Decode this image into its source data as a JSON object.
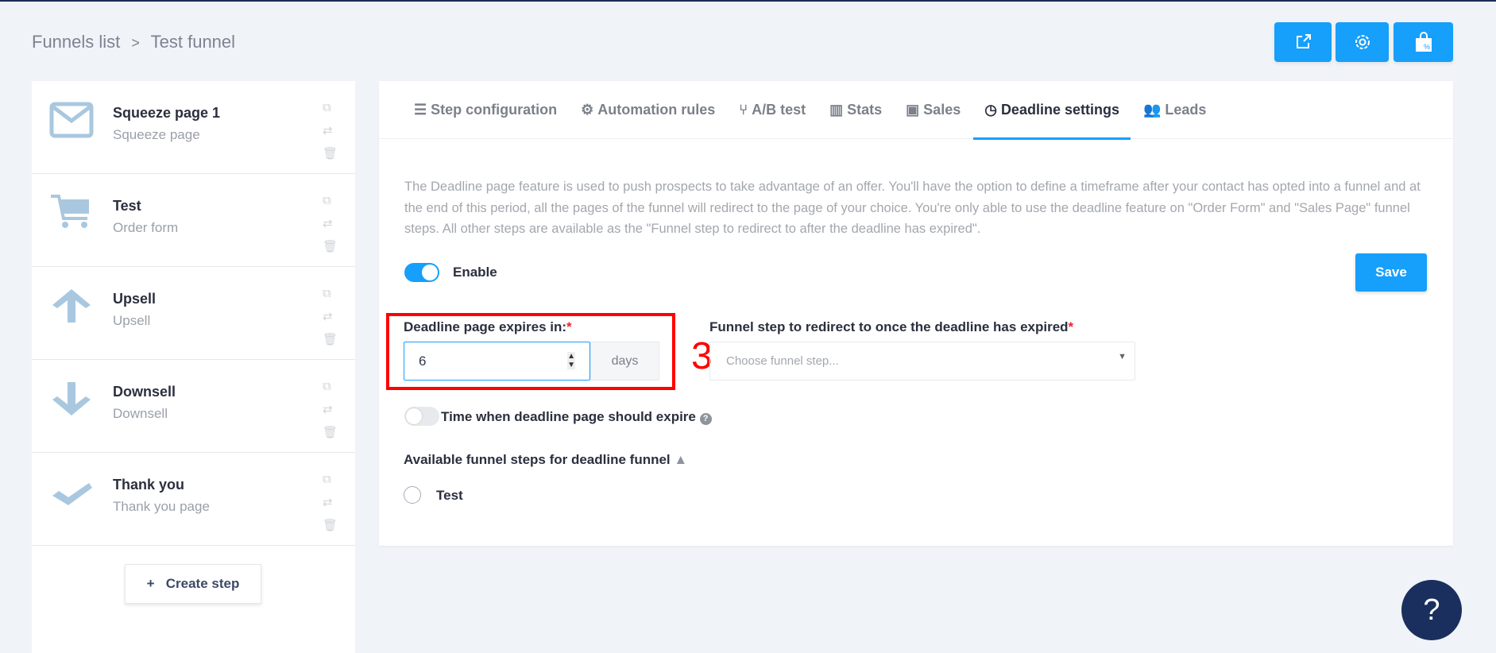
{
  "breadcrumb": {
    "parent": "Funnels list",
    "separator": ">",
    "current": "Test funnel"
  },
  "toolbar": {
    "buttons": [
      {
        "icon": "external-link-icon"
      },
      {
        "icon": "gear-icon"
      },
      {
        "icon": "shopping-bag-percent-icon"
      }
    ]
  },
  "sidebar": {
    "items": [
      {
        "title": "Squeeze page 1",
        "subtitle": "Squeeze page",
        "icon": "envelope-icon"
      },
      {
        "title": "Test",
        "subtitle": "Order form",
        "icon": "cart-icon"
      },
      {
        "title": "Upsell",
        "subtitle": "Upsell",
        "icon": "arrow-up-icon"
      },
      {
        "title": "Downsell",
        "subtitle": "Downsell",
        "icon": "arrow-down-icon"
      },
      {
        "title": "Thank you",
        "subtitle": "Thank you page",
        "icon": "check-icon"
      }
    ],
    "create_label": "+   Create step"
  },
  "tabs": [
    {
      "label": "Step configuration"
    },
    {
      "label": "Automation rules"
    },
    {
      "label": "A/B test"
    },
    {
      "label": "Stats"
    },
    {
      "label": "Sales"
    },
    {
      "label": "Deadline settings",
      "active": true
    },
    {
      "label": "Leads"
    }
  ],
  "deadline": {
    "description": "The Deadline page feature is used to push prospects to take advantage of an offer. You'll have the option to define a timeframe after your contact has opted into a funnel and at the end of this period, all the pages of the funnel will redirect to the page of your choice. You're only able to use the deadline feature on \"Order Form\" and \"Sales Page\" funnel steps. All other steps are available as the \"Funnel step to redirect to after the deadline has expired\".",
    "enable_label": "Enable",
    "enabled": true,
    "save_label": "Save",
    "expires_label": "Deadline page expires in:",
    "expires_value": "6",
    "expires_unit": "days",
    "redirect_label": "Funnel step to redirect to once the deadline has expired",
    "redirect_placeholder": "Choose funnel step...",
    "required_mark": "*",
    "time_label": "Time when deadline page should expire",
    "time_enabled": false,
    "available_label": "Available funnel steps for deadline funnel",
    "available_steps": [
      {
        "label": "Test",
        "selected": false
      }
    ]
  },
  "annotation": {
    "number": "3",
    "color": "#ff0000"
  },
  "help": {
    "label": "?"
  },
  "colors": {
    "accent": "#169ffb",
    "icon": "#a9c8df",
    "help": "#1a2f5e"
  }
}
